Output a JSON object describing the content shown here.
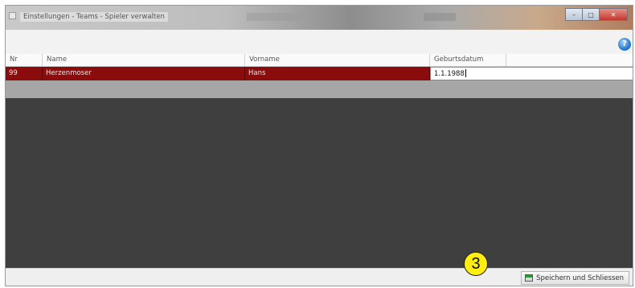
{
  "window": {
    "title": "Einstellungen - Teams - Spieler verwalten",
    "controls": {
      "minimize": "–",
      "maximize": "□",
      "close": "✕"
    }
  },
  "help": {
    "icon": "help-icon",
    "label": "?"
  },
  "grid": {
    "columns": [
      "Nr",
      "Name",
      "Vorname",
      "Geburtsdatum"
    ],
    "rows": [
      {
        "nr": "99",
        "name": "Herzenmoser",
        "vorname": "Hans",
        "geburtsdatum": "1.1.1988"
      }
    ],
    "colors": {
      "selected_row": "#8a0c0c",
      "empty_area": "#3f3f3f"
    }
  },
  "footer": {
    "save_label": "Speichern und Schliessen",
    "save_icon": "save-icon"
  },
  "annotation": {
    "marker": "3"
  }
}
